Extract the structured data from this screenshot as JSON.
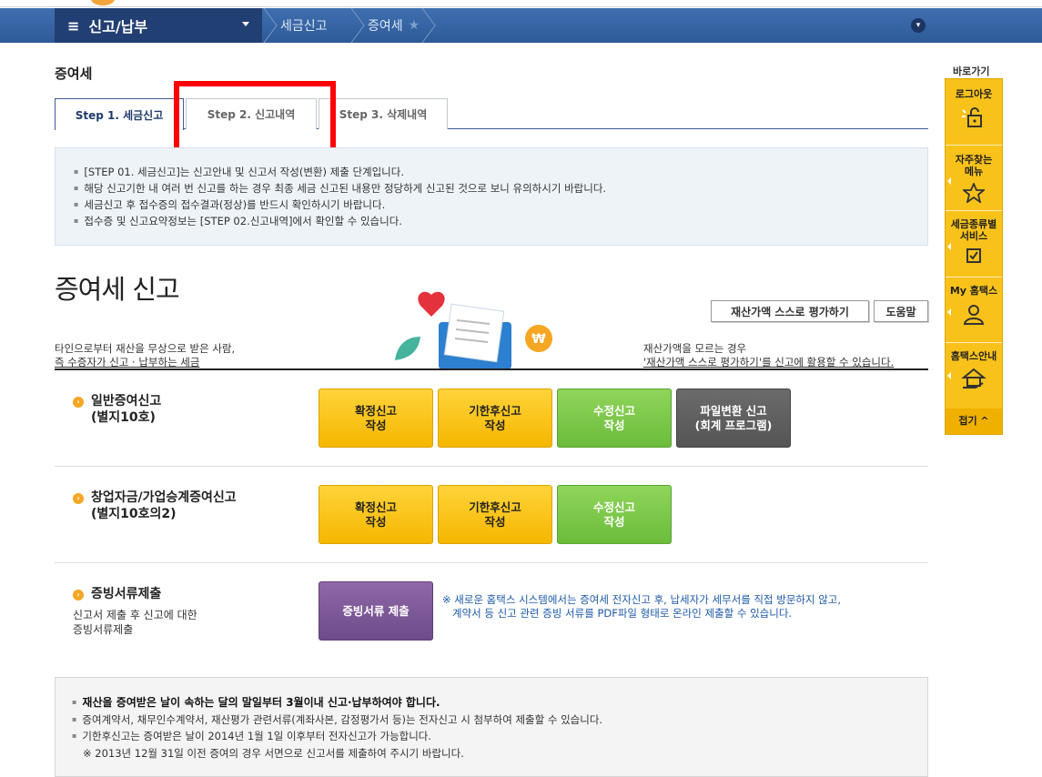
{
  "nav": {
    "menu_title": "신고/납부",
    "crumb1": "세금신고",
    "crumb2": "증여세"
  },
  "page_title": "증여세",
  "tabs": [
    {
      "label": "Step 1. 세금신고"
    },
    {
      "label": "Step 2. 신고내역"
    },
    {
      "label": "Step 3. 삭제내역"
    }
  ],
  "info": [
    "[STEP 01. 세금신고]는 신고안내 및 신고서 작성(변환) 제출 단계입니다.",
    "해당 신고기한 내 여러 번 신고를 하는 경우 최종 세금 신고된 내용만 정당하게 신고된 것으로 보니 유의하시기 바랍니다.",
    "세금신고 후 접수증의 접수결과(정상)를 반드시 확인하시기 바랍니다.",
    "접수증 및 신고요약정보는 [STEP 02.신고내역]에서 확인할 수 있습니다."
  ],
  "main": {
    "heading": "증여세 신고",
    "eval_button": "재산가액 스스로 평가하기",
    "help_button": "도움말",
    "desc_left_1": "타인으로부터 재산을 무상으로 받은 사람,",
    "desc_left_2": "즉 수증자가 신고 · 납부하는 세금",
    "desc_right_1": "재산가액을 모르는 경우",
    "desc_right_2": "'재산가액 스스로 평가하기'를 신고에 활용할 수 있습니다."
  },
  "sections": {
    "general": {
      "title": "일반증여신고",
      "sub": "(별지10호)",
      "buttons": [
        "확정신고\n작성",
        "기한후신고\n작성",
        "수정신고\n작성",
        "파일변환 신고\n(회계 프로그램)"
      ]
    },
    "startup": {
      "title": "창업자금/가업승계증여신고",
      "sub": "(별지10호의2)",
      "buttons": [
        "확정신고\n작성",
        "기한후신고\n작성",
        "수정신고\n작성"
      ]
    },
    "evidence": {
      "title": "증빙서류제출",
      "sub1": "신고서 제출 후 신고에 대한",
      "sub2": "증빙서류제출",
      "button": "증빙서류 제출",
      "note": "※ 새로운 홈택스 시스템에서는 증여세 전자신고 후, 납세자가 세무서를 직접 방문하지 않고,\n   계약서 등 신고 관련 증빙 서류를 PDF파일 형태로 온라인 제출할 수 있습니다."
    }
  },
  "bottom": [
    "재산을 증여받은 날이 속하는 달의 말일부터 3월이내 신고·납부하여야 합니다.",
    "증여계약서, 채무인수계약서, 재산평가 관련서류(계좌사본, 감정평가서 등)는 전자신고 시 첨부하여 제출할 수 있습니다.",
    "기한후신고는 증여받은 날이 2014년 1월 1일 이후부터 전자신고가 가능합니다.",
    "※ 2013년 12월 31일 이전 증여의 경우 서면으로 신고서를 제출하여 주시기 바랍니다."
  ],
  "quick": {
    "title": "바로가기",
    "items": [
      "로그아웃",
      "자주찾는\n메뉴",
      "세금종류별\n서비스",
      "My 홈택스",
      "홈택스안내"
    ],
    "fold": "접기 ^"
  },
  "colors": {
    "nav_bg": "#2e5a98",
    "highlight": "#ff0000",
    "yellow_button": "#f5b700",
    "green_button": "#6cbc3c",
    "gray_button": "#555555",
    "purple_button": "#6e4b8a",
    "quick_menu": "#f9c21a"
  }
}
